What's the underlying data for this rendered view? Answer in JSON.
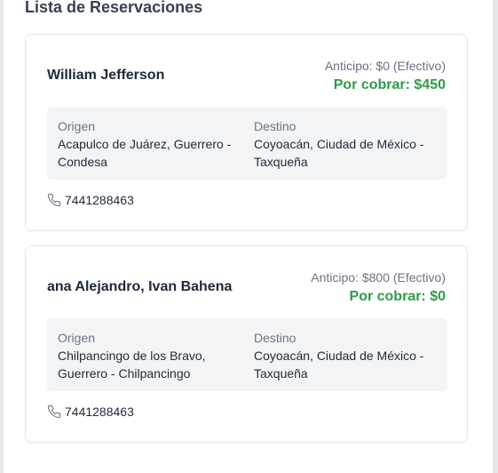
{
  "header": {
    "title": "Lista de Reservaciones"
  },
  "reservations": [
    {
      "name": "William Jefferson",
      "anticipo": "Anticipo: $0 (Efectivo)",
      "por_cobrar": "Por cobrar: $450",
      "origen_label": "Origen",
      "origen": "Acapulco de Juárez, Guerrero - Condesa",
      "destino_label": "Destino",
      "destino": "Coyoacán, Ciudad de México - Taxqueña",
      "phone_icon": "phone-icon",
      "phone": "7441288463"
    },
    {
      "name": "ana Alejandro, Ivan Bahena",
      "anticipo": "Anticipo: $800 (Efectivo)",
      "por_cobrar": "Por cobrar: $0",
      "origen_label": "Origen",
      "origen": "Chilpancingo de los Bravo, Guerrero - Chilpancingo",
      "destino_label": "Destino",
      "destino": "Coyoacán, Ciudad de México - Taxqueña",
      "phone_icon": "phone-icon",
      "phone": "7441288463"
    }
  ],
  "colors": {
    "accent_green": "#2e9b4a",
    "muted_text": "#6b7280",
    "route_bg": "#f3f4f6"
  }
}
